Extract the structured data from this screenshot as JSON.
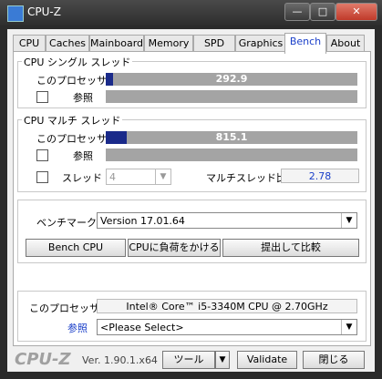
{
  "window": {
    "title": "CPU-Z",
    "min_glyph": "—",
    "max_glyph": "□",
    "close_glyph": "✕"
  },
  "tabs": [
    {
      "label": "CPU"
    },
    {
      "label": "Caches"
    },
    {
      "label": "Mainboard"
    },
    {
      "label": "Memory"
    },
    {
      "label": "SPD"
    },
    {
      "label": "Graphics"
    },
    {
      "label": "Bench"
    },
    {
      "label": "About"
    }
  ],
  "single": {
    "title": "CPU シングル スレッド",
    "this_label": "このプロセッサ",
    "this_value": "292.9",
    "this_fraction": 0.03,
    "ref_label": "参照"
  },
  "multi": {
    "title": "CPU マルチ スレッド",
    "this_label": "このプロセッサ",
    "this_value": "815.1",
    "this_fraction": 0.085,
    "ref_label": "参照",
    "thread_label": "スレッド",
    "thread_value": "4",
    "ratio_label": "マルチスレッド比",
    "ratio_value": "2.78"
  },
  "bench": {
    "label": "ベンチマーク",
    "version": "Version 17.01.64",
    "bench_btn": "Bench CPU",
    "stress_btn": "CPUに負荷をかける",
    "submit_btn": "提出して比較"
  },
  "proc": {
    "this_label": "このプロセッサ",
    "this_value": "Intel® Core™ i5-3340M CPU @ 2.70GHz",
    "ref_label": "参照",
    "ref_select": "<Please Select>"
  },
  "footer": {
    "brand": "CPU-Z",
    "version": "Ver. 1.90.1.x64",
    "tools": "ツール",
    "validate": "Validate",
    "close": "閉じる"
  },
  "colors": {
    "accent": "#1a3fc9",
    "bar_fill": "#1a2a8a",
    "bar_bg": "#a4a4a4"
  }
}
